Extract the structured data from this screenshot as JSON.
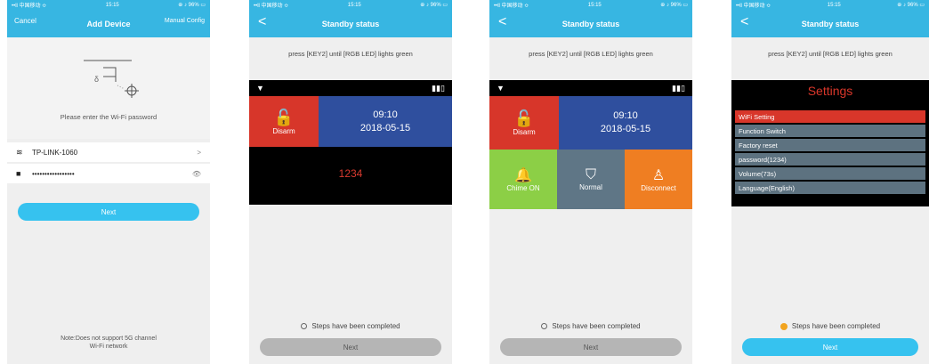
{
  "status_bar": {
    "signal": "••ll 中国移动 ≎",
    "time": "15:15",
    "right": "⊕ ♪ 96% ▭"
  },
  "screen1": {
    "cancel": "Cancel",
    "title": "Add Device",
    "manual": "Manual Config",
    "hint": "Please enter the Wi-Fi password",
    "ssid": "TP-LINK-1060",
    "ssid_end": ">",
    "password": "•••••••••••••••••",
    "eye": "👁",
    "next": "Next",
    "note_line1": "Note:Does not support 5G channel",
    "note_line2": "Wi-Fi network"
  },
  "screen2": {
    "title": "Standby status",
    "instruction": "press [KEY2] until [RGB LED] lights green",
    "disarm": "Disarm",
    "time": "09:10",
    "date": "2018-05-15",
    "code": "1234",
    "progress": "Steps have been completed",
    "next": "Next"
  },
  "screen3": {
    "title": "Standby status",
    "instruction": "press [KEY2] until [RGB LED] lights green",
    "disarm": "Disarm",
    "time": "09:10",
    "date": "2018-05-15",
    "chime": "Chime ON",
    "normal": "Normal",
    "disconnect": "Disconnect",
    "progress": "Steps have been completed",
    "next": "Next"
  },
  "screen4": {
    "title": "Standby status",
    "instruction": "press [KEY2] until [RGB LED] lights green",
    "settings_title": "Settings",
    "menu": [
      "WiFi Setting",
      "Function Switch",
      "Factory reset",
      "password(1234)",
      "Volume(73s)",
      "Language(English)"
    ],
    "progress": "Steps have been completed",
    "next": "Next"
  },
  "colors": {
    "accent": "#37b6e2",
    "button_blue": "#36c2ef",
    "red": "#d7362a",
    "blue": "#2f4f9e",
    "green": "#8ccf46",
    "gray": "#5f7686",
    "orange": "#ef7e22"
  }
}
